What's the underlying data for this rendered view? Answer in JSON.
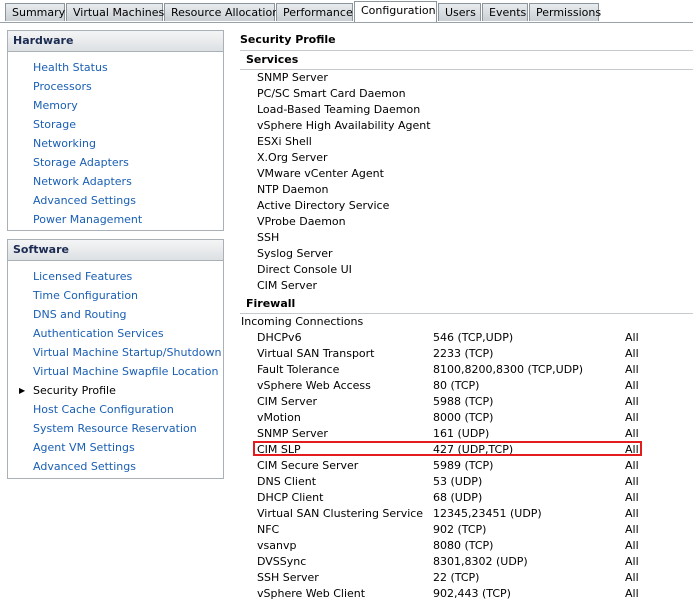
{
  "tabs": [
    "Summary",
    "Virtual Machines",
    "Resource Allocation",
    "Performance",
    "Configuration",
    "Users",
    "Events",
    "Permissions"
  ],
  "active_tab": "Configuration",
  "hardware": {
    "title": "Hardware",
    "items": [
      "Health Status",
      "Processors",
      "Memory",
      "Storage",
      "Networking",
      "Storage Adapters",
      "Network Adapters",
      "Advanced Settings",
      "Power Management"
    ]
  },
  "software": {
    "title": "Software",
    "items": [
      "Licensed Features",
      "Time Configuration",
      "DNS and Routing",
      "Authentication Services",
      "Virtual Machine Startup/Shutdown",
      "Virtual Machine Swapfile Location",
      "Security Profile",
      "Host Cache Configuration",
      "System Resource Reservation",
      "Agent VM Settings",
      "Advanced Settings"
    ],
    "selected": "Security Profile"
  },
  "content": {
    "title": "Security Profile",
    "services_title": "Services",
    "services": [
      "SNMP Server",
      "PC/SC Smart Card Daemon",
      "Load-Based Teaming Daemon",
      "vSphere High Availability Agent",
      "ESXi Shell",
      "X.Org Server",
      "VMware vCenter Agent",
      "NTP Daemon",
      "Active Directory Service",
      "VProbe Daemon",
      "SSH",
      "Syslog Server",
      "Direct Console UI",
      "CIM Server"
    ],
    "firewall_title": "Firewall",
    "incoming_label": "Incoming Connections",
    "firewall_rows": [
      {
        "name": "DHCPv6",
        "ports": "546 (TCP,UDP)",
        "scope": "All"
      },
      {
        "name": "Virtual SAN Transport",
        "ports": "2233 (TCP)",
        "scope": "All"
      },
      {
        "name": "Fault Tolerance",
        "ports": "8100,8200,8300 (TCP,UDP)",
        "scope": "All"
      },
      {
        "name": "vSphere Web Access",
        "ports": "80 (TCP)",
        "scope": "All"
      },
      {
        "name": "CIM Server",
        "ports": "5988 (TCP)",
        "scope": "All"
      },
      {
        "name": "vMotion",
        "ports": "8000 (TCP)",
        "scope": "All"
      },
      {
        "name": "SNMP Server",
        "ports": "161 (UDP)",
        "scope": "All"
      },
      {
        "name": "CIM SLP",
        "ports": "427 (UDP,TCP)",
        "scope": "All"
      },
      {
        "name": "CIM Secure Server",
        "ports": "5989 (TCP)",
        "scope": "All"
      },
      {
        "name": "DNS Client",
        "ports": "53 (UDP)",
        "scope": "All"
      },
      {
        "name": "DHCP Client",
        "ports": "68 (UDP)",
        "scope": "All"
      },
      {
        "name": "Virtual SAN Clustering Service",
        "ports": "12345,23451 (UDP)",
        "scope": "All"
      },
      {
        "name": "NFC",
        "ports": "902 (TCP)",
        "scope": "All"
      },
      {
        "name": "vsanvp",
        "ports": "8080 (TCP)",
        "scope": "All"
      },
      {
        "name": "DVSSync",
        "ports": "8301,8302 (UDP)",
        "scope": "All"
      },
      {
        "name": "SSH Server",
        "ports": "22 (TCP)",
        "scope": "All"
      },
      {
        "name": "vSphere Web Client",
        "ports": "902,443 (TCP)",
        "scope": "All"
      }
    ],
    "highlighted_row": "CIM SLP"
  },
  "colors": {
    "link": "#1a5fb4",
    "highlight": "#e31d1d",
    "header_text": "#1c2b52"
  }
}
